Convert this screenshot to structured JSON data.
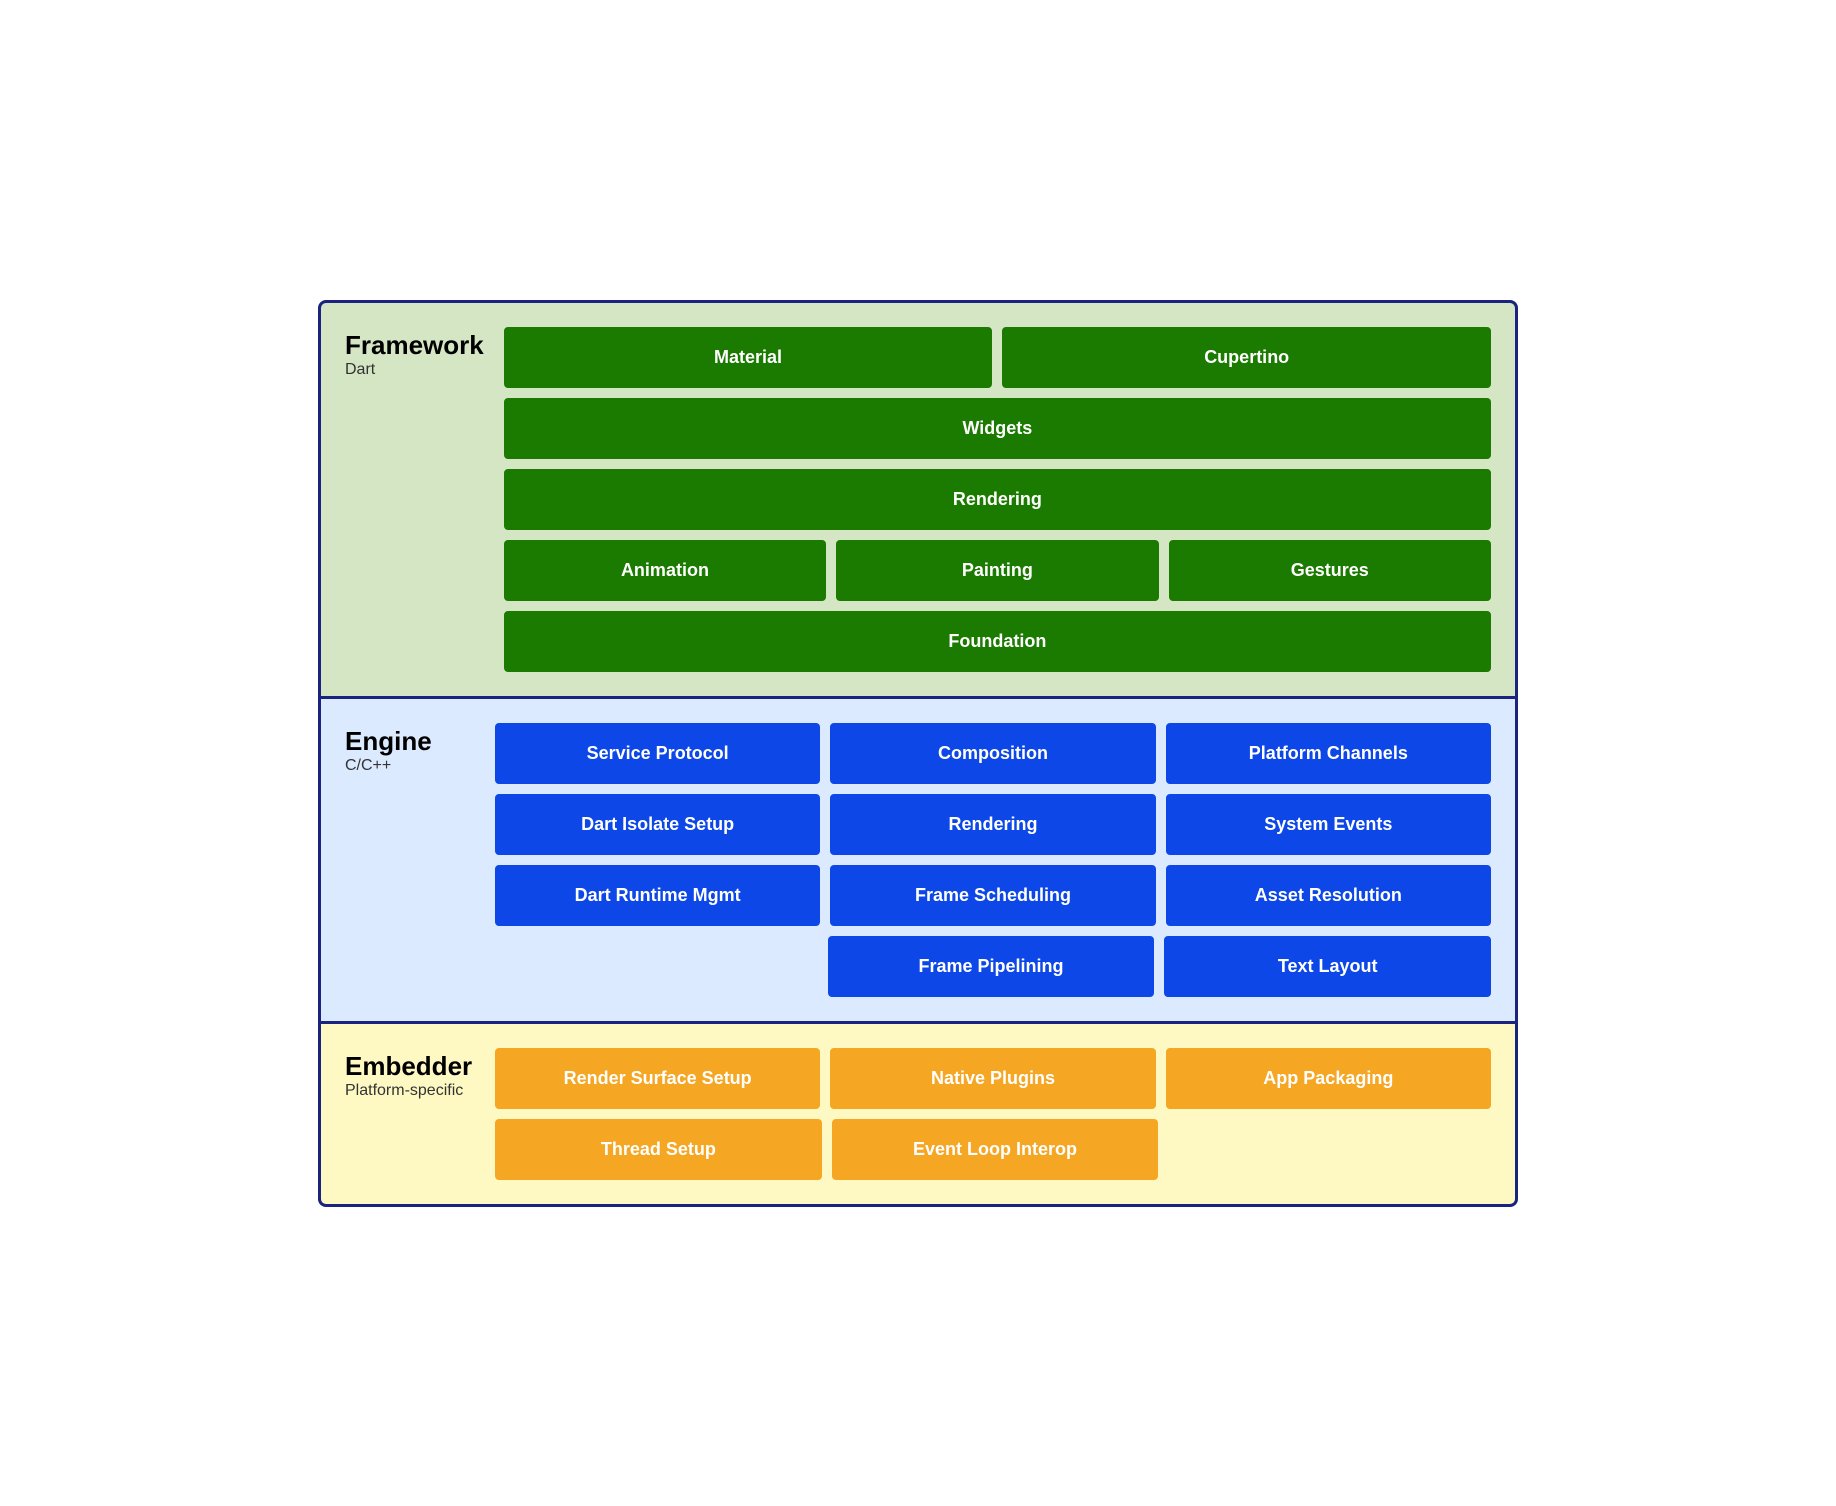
{
  "layers": {
    "framework": {
      "title": "Framework",
      "subtitle": "Dart",
      "bg": "#d4e6c3",
      "rows": [
        [
          {
            "label": "Material",
            "type": "green"
          },
          {
            "label": "Cupertino",
            "type": "green"
          }
        ],
        [
          {
            "label": "Widgets",
            "type": "green",
            "full": true
          }
        ],
        [
          {
            "label": "Rendering",
            "type": "green",
            "full": true
          }
        ],
        [
          {
            "label": "Animation",
            "type": "green"
          },
          {
            "label": "Painting",
            "type": "green"
          },
          {
            "label": "Gestures",
            "type": "green"
          }
        ],
        [
          {
            "label": "Foundation",
            "type": "green",
            "full": true
          }
        ]
      ]
    },
    "engine": {
      "title": "Engine",
      "subtitle": "C/C++",
      "bg": "#dbeafe",
      "rows": [
        [
          {
            "label": "Service Protocol",
            "type": "blue"
          },
          {
            "label": "Composition",
            "type": "blue"
          },
          {
            "label": "Platform Channels",
            "type": "blue"
          }
        ],
        [
          {
            "label": "Dart Isolate Setup",
            "type": "blue"
          },
          {
            "label": "Rendering",
            "type": "blue"
          },
          {
            "label": "System Events",
            "type": "blue"
          }
        ],
        [
          {
            "label": "Dart Runtime Mgmt",
            "type": "blue"
          },
          {
            "label": "Frame Scheduling",
            "type": "blue"
          },
          {
            "label": "Asset Resolution",
            "type": "blue"
          }
        ],
        [
          {
            "label": "",
            "type": "spacer"
          },
          {
            "label": "Frame Pipelining",
            "type": "blue"
          },
          {
            "label": "Text Layout",
            "type": "blue"
          }
        ]
      ]
    },
    "embedder": {
      "title": "Embedder",
      "subtitle": "Platform-specific",
      "bg": "#fef9c3",
      "rows": [
        [
          {
            "label": "Render Surface Setup",
            "type": "orange"
          },
          {
            "label": "Native Plugins",
            "type": "orange"
          },
          {
            "label": "App Packaging",
            "type": "orange"
          }
        ],
        [
          {
            "label": "Thread Setup",
            "type": "orange"
          },
          {
            "label": "Event Loop Interop",
            "type": "orange"
          },
          {
            "label": "",
            "type": "spacer"
          }
        ]
      ]
    }
  }
}
